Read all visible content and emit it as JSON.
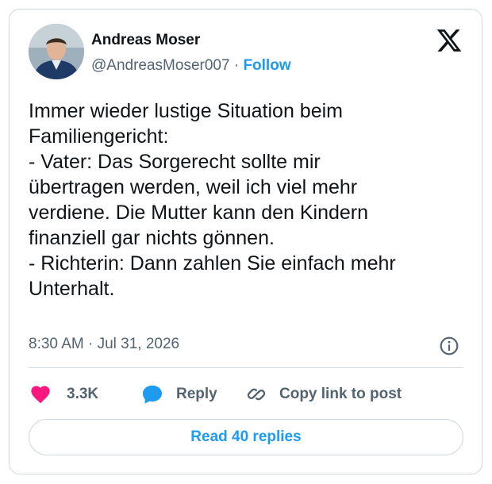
{
  "author": {
    "name": "Andreas Moser",
    "handle": "@AndreasMoser007",
    "separator": "·",
    "follow_label": "Follow"
  },
  "tweet": {
    "text": "Immer wieder lustige Situation beim\nFamiliengericht:\n- Vater: Das Sorgerecht sollte mir\nübertragen werden, weil ich viel mehr\nverdiene. Die Mutter kann den Kindern\nfinanziell gar nichts gönnen.\n- Richterin: Dann zahlen Sie einfach mehr\nUnterhalt.",
    "timestamp": "8:30 AM · Jul 31, 2026"
  },
  "actions": {
    "likes_count": "3.3K",
    "reply_label": "Reply",
    "copy_link_label": "Copy link to post"
  },
  "read_replies_label": "Read 40 replies",
  "icons": {
    "brand": "x-logo-icon",
    "info": "info-icon",
    "like": "heart-icon",
    "reply": "speech-bubble-icon",
    "copy": "link-icon"
  },
  "colors": {
    "accent": "#1d9bf0",
    "like": "#f91880",
    "text": "#0f1419",
    "muted": "#536471",
    "border": "#cfd9de"
  }
}
